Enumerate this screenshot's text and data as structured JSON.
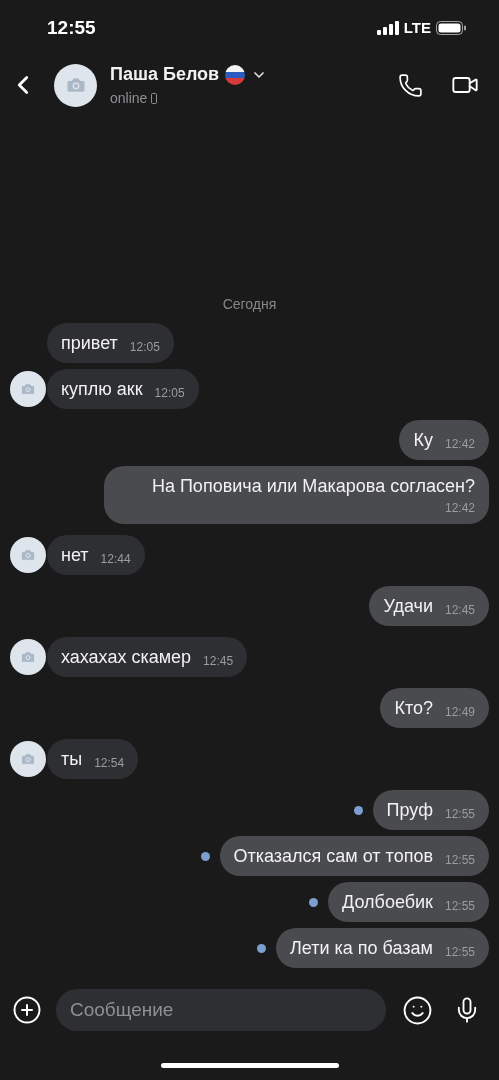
{
  "status_bar": {
    "time": "12:55",
    "network": "LTE"
  },
  "header": {
    "name": "Паша Белов",
    "status": "online"
  },
  "date_divider": "Сегодня",
  "messages": [
    {
      "kind": "in",
      "text": "привет",
      "time": "12:05",
      "avatar": false
    },
    {
      "kind": "in",
      "text": "куплю акк",
      "time": "12:05",
      "avatar": true
    },
    {
      "kind": "out",
      "text": "Ку",
      "time": "12:42",
      "unread": false
    },
    {
      "kind": "out",
      "text": "На Поповича или Макарова согласен?",
      "time": "12:42",
      "unread": false
    },
    {
      "kind": "in",
      "text": "нет",
      "time": "12:44",
      "avatar": true
    },
    {
      "kind": "out",
      "text": "Удачи",
      "time": "12:45",
      "unread": false
    },
    {
      "kind": "in",
      "text": "хахахах скамер",
      "time": "12:45",
      "avatar": true
    },
    {
      "kind": "out",
      "text": "Кто?",
      "time": "12:49",
      "unread": false
    },
    {
      "kind": "in",
      "text": "ты",
      "time": "12:54",
      "avatar": true
    },
    {
      "kind": "out",
      "text": "Пруф",
      "time": "12:55",
      "unread": true
    },
    {
      "kind": "out",
      "text": "Отказался сам от топов",
      "time": "12:55",
      "unread": true
    },
    {
      "kind": "out",
      "text": "Долбоебик",
      "time": "12:55",
      "unread": true
    },
    {
      "kind": "out",
      "text": "Лети ка по базам",
      "time": "12:55",
      "unread": true
    }
  ],
  "composer": {
    "placeholder": "Сообщение"
  }
}
